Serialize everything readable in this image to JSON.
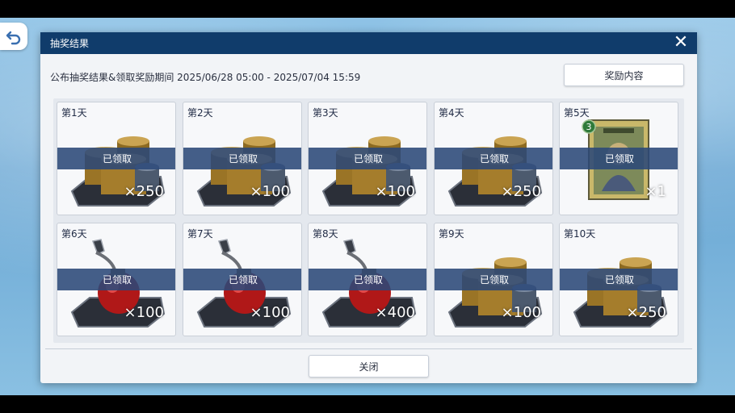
{
  "dialog": {
    "title": "抽奖结果",
    "period": "公布抽奖结果&领取奖励期间 2025/06/28 05:00 - 2025/07/04 15:59",
    "reward_button": "奖励内容",
    "close_button": "关闭",
    "close_icon": "✕"
  },
  "icons": {
    "back": "back-arrow-icon",
    "close": "close-icon"
  },
  "claimed_label": "已领取",
  "rewards": [
    {
      "day": "第1天",
      "item": "coins",
      "qty": "×250",
      "status": "已领取"
    },
    {
      "day": "第2天",
      "item": "coins",
      "qty": "×100",
      "status": "已领取"
    },
    {
      "day": "第3天",
      "item": "coins",
      "qty": "×100",
      "status": "已领取"
    },
    {
      "day": "第4天",
      "item": "coins",
      "qty": "×250",
      "status": "已领取"
    },
    {
      "day": "第5天",
      "item": "card",
      "qty": "×1",
      "status": "已领取",
      "card_badge": "3"
    },
    {
      "day": "第6天",
      "item": "potion",
      "qty": "×100",
      "status": "已领取"
    },
    {
      "day": "第7天",
      "item": "potion",
      "qty": "×100",
      "status": "已领取"
    },
    {
      "day": "第8天",
      "item": "potion",
      "qty": "×400",
      "status": "已领取"
    },
    {
      "day": "第9天",
      "item": "coins",
      "qty": "×100",
      "status": "已领取"
    },
    {
      "day": "第10天",
      "item": "coins",
      "qty": "×250",
      "status": "已领取"
    }
  ],
  "colors": {
    "title_bar": "#103c6b",
    "claimed_band": "#2b4878"
  }
}
